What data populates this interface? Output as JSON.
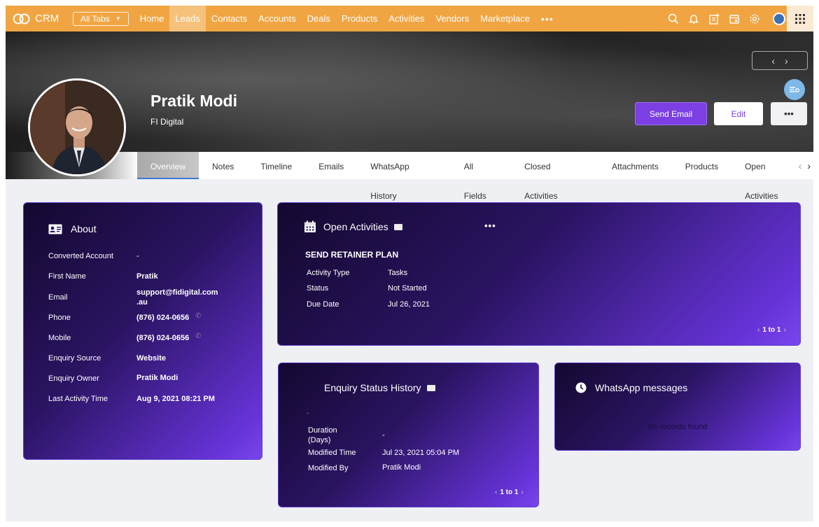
{
  "nav": {
    "brand": "CRM",
    "all_tabs": "All Tabs",
    "links": [
      "Home",
      "Leads",
      "Contacts",
      "Accounts",
      "Deals",
      "Products",
      "Activities",
      "Vendors",
      "Marketplace"
    ],
    "active_link": "Leads",
    "more": "•••",
    "icons": [
      "search-icon",
      "bell-icon",
      "add-note-icon",
      "calendar-icon",
      "settings-icon",
      "user-avatar-icon",
      "apps-grid-icon"
    ],
    "accent_color": "#f1a542"
  },
  "header": {
    "name": "Pratik Modi",
    "company": "FI Digital",
    "send_email": "Send Email",
    "edit": "Edit",
    "more": "•••",
    "prev": "‹",
    "next": "›"
  },
  "tabs": [
    "Overview",
    "Notes",
    "Timeline",
    "Emails",
    "WhatsApp History",
    "All Fields",
    "Closed Activities",
    "Attachments",
    "Products",
    "Open Activities"
  ],
  "active_tab": "Overview",
  "about": {
    "title": "About",
    "fields": [
      {
        "label": "Converted Account",
        "value": "-"
      },
      {
        "label": "First Name",
        "value": "Pratik"
      },
      {
        "label": "Email",
        "value": "support@fidigital.com\n.au"
      },
      {
        "label": "Phone",
        "value": "(876) 024-0656"
      },
      {
        "label": "Mobile",
        "value": "(876) 024-0656"
      },
      {
        "label": "Enquiry Source",
        "value": "Website"
      },
      {
        "label": "Enquiry Owner",
        "value": "Pratik Modi"
      },
      {
        "label": "Last Activity Time",
        "value": "Aug 9, 2021 08:21 PM"
      }
    ]
  },
  "open_activities": {
    "title": "Open Activities",
    "more": "•••",
    "item_title": "SEND RETAINER PLAN",
    "fields": [
      {
        "label": "Activity Type",
        "value": "Tasks"
      },
      {
        "label": "Status",
        "value": "Not Started"
      },
      {
        "label": "Due Date",
        "value": "Jul 26, 2021"
      }
    ],
    "pager": "1 to 1"
  },
  "enquiry_history": {
    "title": "Enquiry Status History",
    "dash": "-",
    "fields": [
      {
        "label": "Duration\n(Days)",
        "value": "-"
      },
      {
        "label": "Modified Time",
        "value": "Jul 23, 2021 05:04 PM"
      },
      {
        "label": "Modified By",
        "value": "Pratik Modi"
      }
    ],
    "pager": "1 to 1"
  },
  "whatsapp": {
    "title": "WhatsApp messages",
    "empty": "No records found"
  }
}
